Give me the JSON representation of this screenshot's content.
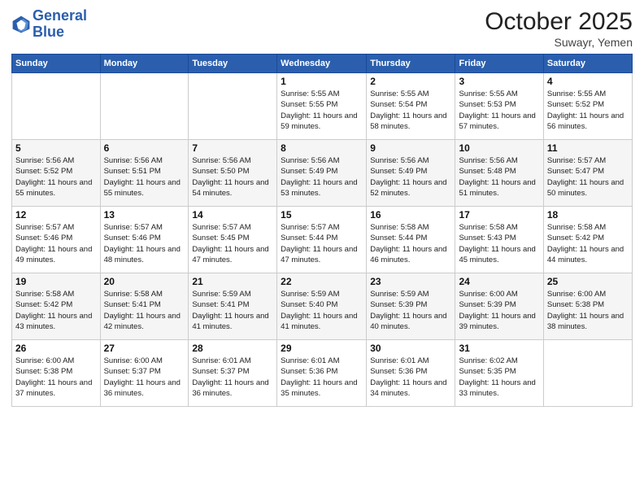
{
  "header": {
    "logo_line1": "General",
    "logo_line2": "Blue",
    "month": "October 2025",
    "location": "Suwayr, Yemen"
  },
  "weekdays": [
    "Sunday",
    "Monday",
    "Tuesday",
    "Wednesday",
    "Thursday",
    "Friday",
    "Saturday"
  ],
  "weeks": [
    [
      {
        "day": "",
        "sunrise": "",
        "sunset": "",
        "daylight": ""
      },
      {
        "day": "",
        "sunrise": "",
        "sunset": "",
        "daylight": ""
      },
      {
        "day": "",
        "sunrise": "",
        "sunset": "",
        "daylight": ""
      },
      {
        "day": "1",
        "sunrise": "Sunrise: 5:55 AM",
        "sunset": "Sunset: 5:55 PM",
        "daylight": "Daylight: 11 hours and 59 minutes."
      },
      {
        "day": "2",
        "sunrise": "Sunrise: 5:55 AM",
        "sunset": "Sunset: 5:54 PM",
        "daylight": "Daylight: 11 hours and 58 minutes."
      },
      {
        "day": "3",
        "sunrise": "Sunrise: 5:55 AM",
        "sunset": "Sunset: 5:53 PM",
        "daylight": "Daylight: 11 hours and 57 minutes."
      },
      {
        "day": "4",
        "sunrise": "Sunrise: 5:55 AM",
        "sunset": "Sunset: 5:52 PM",
        "daylight": "Daylight: 11 hours and 56 minutes."
      }
    ],
    [
      {
        "day": "5",
        "sunrise": "Sunrise: 5:56 AM",
        "sunset": "Sunset: 5:52 PM",
        "daylight": "Daylight: 11 hours and 55 minutes."
      },
      {
        "day": "6",
        "sunrise": "Sunrise: 5:56 AM",
        "sunset": "Sunset: 5:51 PM",
        "daylight": "Daylight: 11 hours and 55 minutes."
      },
      {
        "day": "7",
        "sunrise": "Sunrise: 5:56 AM",
        "sunset": "Sunset: 5:50 PM",
        "daylight": "Daylight: 11 hours and 54 minutes."
      },
      {
        "day": "8",
        "sunrise": "Sunrise: 5:56 AM",
        "sunset": "Sunset: 5:49 PM",
        "daylight": "Daylight: 11 hours and 53 minutes."
      },
      {
        "day": "9",
        "sunrise": "Sunrise: 5:56 AM",
        "sunset": "Sunset: 5:49 PM",
        "daylight": "Daylight: 11 hours and 52 minutes."
      },
      {
        "day": "10",
        "sunrise": "Sunrise: 5:56 AM",
        "sunset": "Sunset: 5:48 PM",
        "daylight": "Daylight: 11 hours and 51 minutes."
      },
      {
        "day": "11",
        "sunrise": "Sunrise: 5:57 AM",
        "sunset": "Sunset: 5:47 PM",
        "daylight": "Daylight: 11 hours and 50 minutes."
      }
    ],
    [
      {
        "day": "12",
        "sunrise": "Sunrise: 5:57 AM",
        "sunset": "Sunset: 5:46 PM",
        "daylight": "Daylight: 11 hours and 49 minutes."
      },
      {
        "day": "13",
        "sunrise": "Sunrise: 5:57 AM",
        "sunset": "Sunset: 5:46 PM",
        "daylight": "Daylight: 11 hours and 48 minutes."
      },
      {
        "day": "14",
        "sunrise": "Sunrise: 5:57 AM",
        "sunset": "Sunset: 5:45 PM",
        "daylight": "Daylight: 11 hours and 47 minutes."
      },
      {
        "day": "15",
        "sunrise": "Sunrise: 5:57 AM",
        "sunset": "Sunset: 5:44 PM",
        "daylight": "Daylight: 11 hours and 47 minutes."
      },
      {
        "day": "16",
        "sunrise": "Sunrise: 5:58 AM",
        "sunset": "Sunset: 5:44 PM",
        "daylight": "Daylight: 11 hours and 46 minutes."
      },
      {
        "day": "17",
        "sunrise": "Sunrise: 5:58 AM",
        "sunset": "Sunset: 5:43 PM",
        "daylight": "Daylight: 11 hours and 45 minutes."
      },
      {
        "day": "18",
        "sunrise": "Sunrise: 5:58 AM",
        "sunset": "Sunset: 5:42 PM",
        "daylight": "Daylight: 11 hours and 44 minutes."
      }
    ],
    [
      {
        "day": "19",
        "sunrise": "Sunrise: 5:58 AM",
        "sunset": "Sunset: 5:42 PM",
        "daylight": "Daylight: 11 hours and 43 minutes."
      },
      {
        "day": "20",
        "sunrise": "Sunrise: 5:58 AM",
        "sunset": "Sunset: 5:41 PM",
        "daylight": "Daylight: 11 hours and 42 minutes."
      },
      {
        "day": "21",
        "sunrise": "Sunrise: 5:59 AM",
        "sunset": "Sunset: 5:41 PM",
        "daylight": "Daylight: 11 hours and 41 minutes."
      },
      {
        "day": "22",
        "sunrise": "Sunrise: 5:59 AM",
        "sunset": "Sunset: 5:40 PM",
        "daylight": "Daylight: 11 hours and 41 minutes."
      },
      {
        "day": "23",
        "sunrise": "Sunrise: 5:59 AM",
        "sunset": "Sunset: 5:39 PM",
        "daylight": "Daylight: 11 hours and 40 minutes."
      },
      {
        "day": "24",
        "sunrise": "Sunrise: 6:00 AM",
        "sunset": "Sunset: 5:39 PM",
        "daylight": "Daylight: 11 hours and 39 minutes."
      },
      {
        "day": "25",
        "sunrise": "Sunrise: 6:00 AM",
        "sunset": "Sunset: 5:38 PM",
        "daylight": "Daylight: 11 hours and 38 minutes."
      }
    ],
    [
      {
        "day": "26",
        "sunrise": "Sunrise: 6:00 AM",
        "sunset": "Sunset: 5:38 PM",
        "daylight": "Daylight: 11 hours and 37 minutes."
      },
      {
        "day": "27",
        "sunrise": "Sunrise: 6:00 AM",
        "sunset": "Sunset: 5:37 PM",
        "daylight": "Daylight: 11 hours and 36 minutes."
      },
      {
        "day": "28",
        "sunrise": "Sunrise: 6:01 AM",
        "sunset": "Sunset: 5:37 PM",
        "daylight": "Daylight: 11 hours and 36 minutes."
      },
      {
        "day": "29",
        "sunrise": "Sunrise: 6:01 AM",
        "sunset": "Sunset: 5:36 PM",
        "daylight": "Daylight: 11 hours and 35 minutes."
      },
      {
        "day": "30",
        "sunrise": "Sunrise: 6:01 AM",
        "sunset": "Sunset: 5:36 PM",
        "daylight": "Daylight: 11 hours and 34 minutes."
      },
      {
        "day": "31",
        "sunrise": "Sunrise: 6:02 AM",
        "sunset": "Sunset: 5:35 PM",
        "daylight": "Daylight: 11 hours and 33 minutes."
      },
      {
        "day": "",
        "sunrise": "",
        "sunset": "",
        "daylight": ""
      }
    ]
  ]
}
